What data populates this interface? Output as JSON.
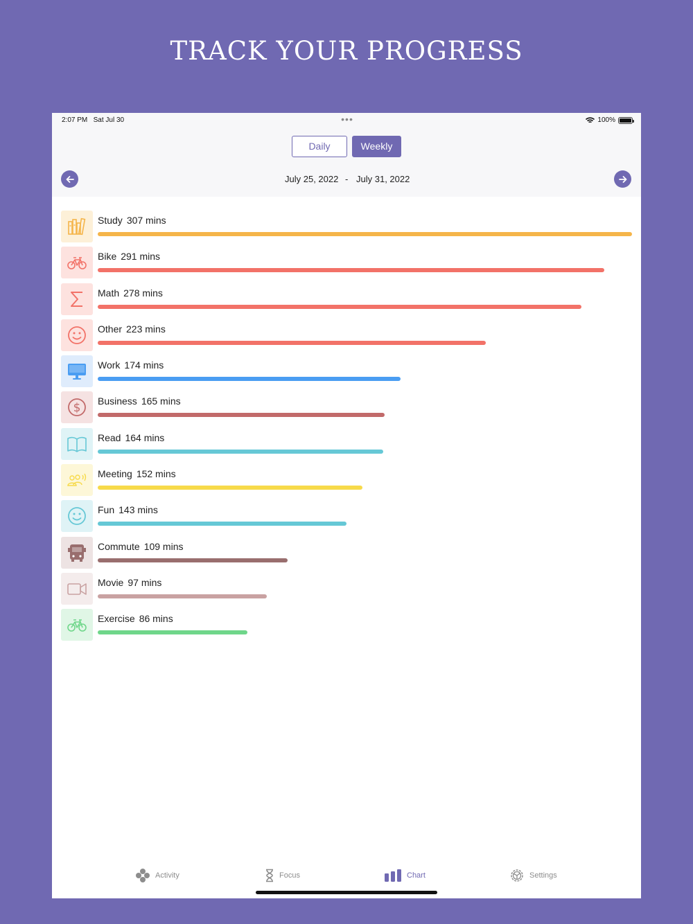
{
  "headline": "TRACK YOUR PROGRESS",
  "status": {
    "time": "2:07 PM",
    "date": "Sat Jul 30",
    "battery": "100%"
  },
  "segments": {
    "daily": "Daily",
    "weekly": "Weekly",
    "selected": "weekly"
  },
  "range": {
    "start": "July 25, 2022",
    "separator": "-",
    "end": "July 31, 2022"
  },
  "theme": {
    "accent": "#7069b2"
  },
  "chart_data": {
    "type": "bar",
    "categories": [
      "Study",
      "Bike",
      "Math",
      "Other",
      "Work",
      "Business",
      "Read",
      "Meeting",
      "Fun",
      "Commute",
      "Movie",
      "Exercise"
    ],
    "values": [
      307,
      291,
      278,
      223,
      174,
      165,
      164,
      152,
      143,
      109,
      97,
      86
    ],
    "value_labels": [
      "307 mins",
      "291 mins",
      "278 mins",
      "223 mins",
      "174 mins",
      "165 mins",
      "164 mins",
      "152 mins",
      "143 mins",
      "109 mins",
      "97 mins",
      "86 mins"
    ],
    "colors": [
      "#f5b54a",
      "#f27268",
      "#f27268",
      "#f27268",
      "#4a9df2",
      "#c26a6a",
      "#66c8d6",
      "#f7da4a",
      "#66c8d6",
      "#996e6e",
      "#c9a2a2",
      "#6fd68a"
    ],
    "tile_colors": [
      "#fdf0d8",
      "#fde2df",
      "#fde2df",
      "#fde2df",
      "#dfecfc",
      "#f5e2e2",
      "#dff3f6",
      "#fdf7d8",
      "#dff3f6",
      "#ede3e3",
      "#f4ecec",
      "#e0f6e6"
    ],
    "icons": [
      "books-icon",
      "bicycle-icon",
      "sigma-icon",
      "smiley-icon",
      "monitor-icon",
      "dollar-icon",
      "open-book-icon",
      "meeting-icon",
      "smiley-icon",
      "bus-icon",
      "video-camera-icon",
      "bicycle-icon"
    ],
    "title": "",
    "xlabel": "",
    "ylabel": ""
  },
  "tabs": [
    {
      "label": "Activity",
      "icon": "dots-cluster-icon"
    },
    {
      "label": "Focus",
      "icon": "hourglass-icon"
    },
    {
      "label": "Chart",
      "icon": "bar-chart-icon",
      "selected": true
    },
    {
      "label": "Settings",
      "icon": "gear-icon"
    }
  ]
}
